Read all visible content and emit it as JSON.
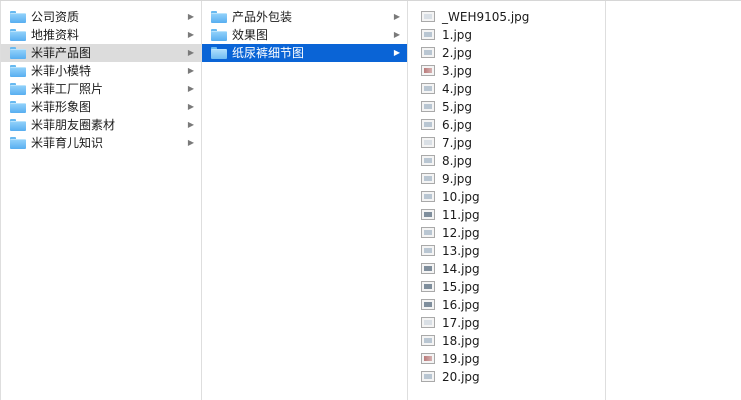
{
  "column1": {
    "items": [
      {
        "label": "公司资质",
        "state": "normal"
      },
      {
        "label": "地推资料",
        "state": "normal"
      },
      {
        "label": "米菲产品图",
        "state": "selected-gray"
      },
      {
        "label": "米菲小模特",
        "state": "normal"
      },
      {
        "label": "米菲工厂照片",
        "state": "normal"
      },
      {
        "label": "米菲形象图",
        "state": "normal"
      },
      {
        "label": "米菲朋友圈素材",
        "state": "normal"
      },
      {
        "label": "米菲育儿知识",
        "state": "normal"
      }
    ]
  },
  "column2": {
    "items": [
      {
        "label": "产品外包装",
        "state": "normal"
      },
      {
        "label": "效果图",
        "state": "normal"
      },
      {
        "label": "纸尿裤细节图",
        "state": "selected-blue"
      }
    ]
  },
  "column3": {
    "files": [
      {
        "label": "_WEH9105.jpg",
        "thumb": "pale"
      },
      {
        "label": "1.jpg",
        "thumb": "normal"
      },
      {
        "label": "2.jpg",
        "thumb": "normal"
      },
      {
        "label": "3.jpg",
        "thumb": "red"
      },
      {
        "label": "4.jpg",
        "thumb": "normal"
      },
      {
        "label": "5.jpg",
        "thumb": "normal"
      },
      {
        "label": "6.jpg",
        "thumb": "normal"
      },
      {
        "label": "7.jpg",
        "thumb": "pale"
      },
      {
        "label": "8.jpg",
        "thumb": "normal"
      },
      {
        "label": "9.jpg",
        "thumb": "normal"
      },
      {
        "label": "10.jpg",
        "thumb": "normal"
      },
      {
        "label": "11.jpg",
        "thumb": "dark"
      },
      {
        "label": "12.jpg",
        "thumb": "normal"
      },
      {
        "label": "13.jpg",
        "thumb": "normal"
      },
      {
        "label": "14.jpg",
        "thumb": "dark"
      },
      {
        "label": "15.jpg",
        "thumb": "dark"
      },
      {
        "label": "16.jpg",
        "thumb": "dark"
      },
      {
        "label": "17.jpg",
        "thumb": "pale"
      },
      {
        "label": "18.jpg",
        "thumb": "normal"
      },
      {
        "label": "19.jpg",
        "thumb": "red"
      },
      {
        "label": "20.jpg",
        "thumb": "normal"
      }
    ]
  },
  "icons": {
    "folder": "folder-icon",
    "file": "image-file-icon",
    "disclosure": "chevron-right-icon",
    "disclosure_glyph": "▶"
  },
  "colors": {
    "selection_blue": "#0a64d6",
    "selection_gray": "#dcdcdc",
    "folder_blue": "#58aef0"
  }
}
